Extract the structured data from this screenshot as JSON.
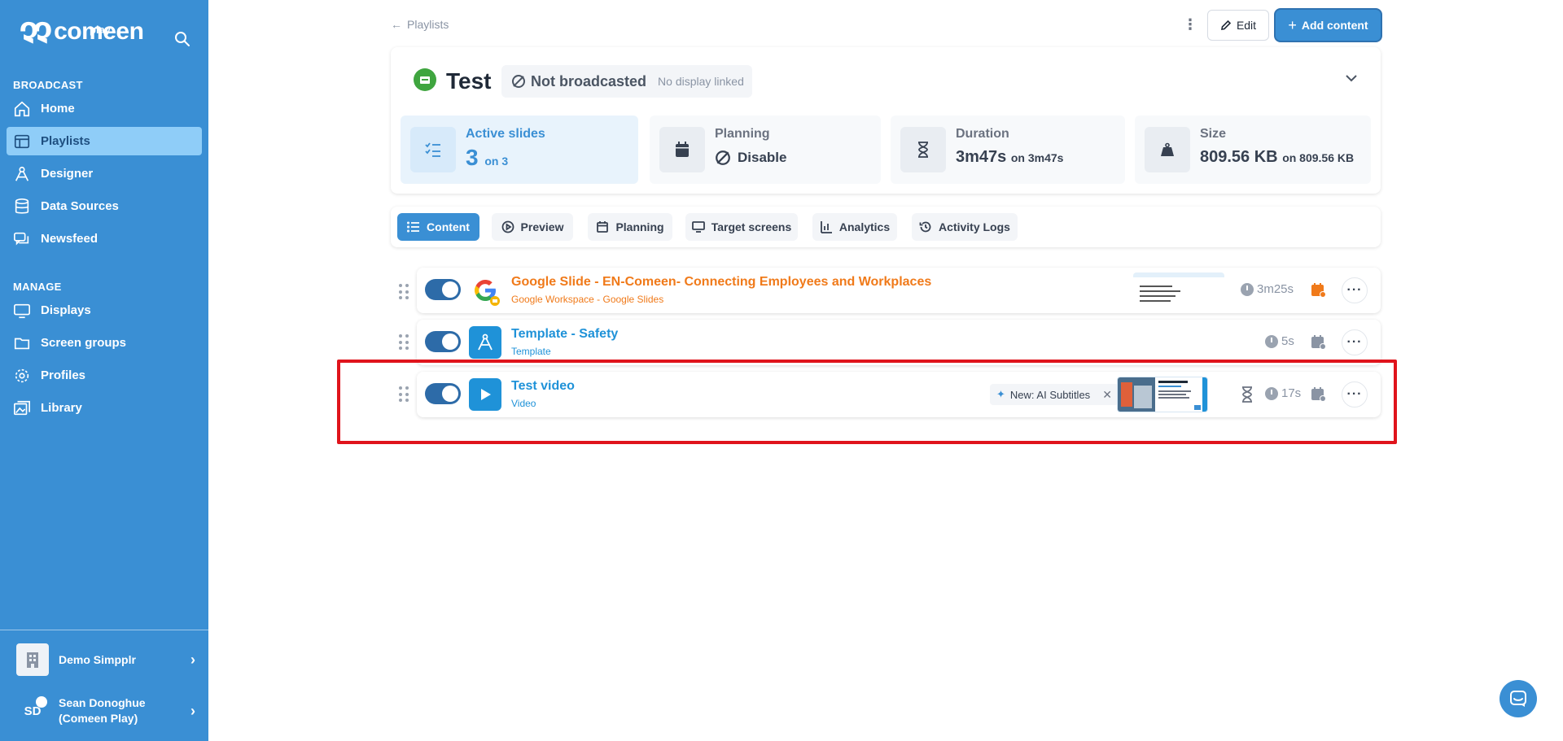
{
  "sidebar": {
    "logo_text": "comeen",
    "logo_sub": "play",
    "sections": [
      {
        "label": "BROADCAST"
      },
      {
        "label": "MANAGE"
      }
    ],
    "broadcast_items": [
      {
        "label": "Home",
        "icon": "home-icon"
      },
      {
        "label": "Playlists",
        "icon": "playlist-icon",
        "active": true
      },
      {
        "label": "Designer",
        "icon": "designer-icon"
      },
      {
        "label": "Data Sources",
        "icon": "database-icon"
      },
      {
        "label": "Newsfeed",
        "icon": "newsfeed-icon"
      }
    ],
    "manage_items": [
      {
        "label": "Displays",
        "icon": "display-icon"
      },
      {
        "label": "Screen groups",
        "icon": "folder-icon"
      },
      {
        "label": "Profiles",
        "icon": "gear-icon"
      },
      {
        "label": "Library",
        "icon": "library-icon"
      }
    ],
    "organization": "Demo Simpplr",
    "user": {
      "initials": "SD",
      "name_line1": "Sean Donoghue",
      "name_line2": "(Comeen Play)"
    }
  },
  "header": {
    "back_label": "Playlists",
    "edit_label": "Edit",
    "add_label": "Add content"
  },
  "playlist": {
    "title": "Test",
    "status": "Not broadcasted",
    "status_sub": "No display linked",
    "stats": {
      "active": {
        "label": "Active slides",
        "value": "3",
        "suffix": "on 3"
      },
      "planning": {
        "label": "Planning",
        "value": "Disable"
      },
      "duration": {
        "label": "Duration",
        "value": "3m47s",
        "suffix": "on 3m47s"
      },
      "size": {
        "label": "Size",
        "value": "809.56 KB",
        "suffix": "on 809.56 KB"
      }
    }
  },
  "tabs": [
    {
      "label": "Content",
      "active": true
    },
    {
      "label": "Preview"
    },
    {
      "label": "Planning"
    },
    {
      "label": "Target screens"
    },
    {
      "label": "Analytics"
    },
    {
      "label": "Activity Logs"
    }
  ],
  "slides": [
    {
      "title": "Google Slide - EN-Comeen- Connecting Employees and Workplaces",
      "subtitle": "Google Workspace - Google Slides",
      "duration": "3m25s",
      "enabled": true
    },
    {
      "title": "Template - Safety",
      "subtitle": "Template",
      "duration": "5s",
      "enabled": true
    },
    {
      "title": "Test video",
      "subtitle": "Video",
      "duration": "17s",
      "enabled": true,
      "chip": "New: AI Subtitles"
    }
  ],
  "colors": {
    "sidebar": "#3a8fd4",
    "active_nav": "#8fcdf8",
    "accent": "#3a8fd4",
    "google_orange": "#f07a1a",
    "highlight": "#e0141c"
  }
}
